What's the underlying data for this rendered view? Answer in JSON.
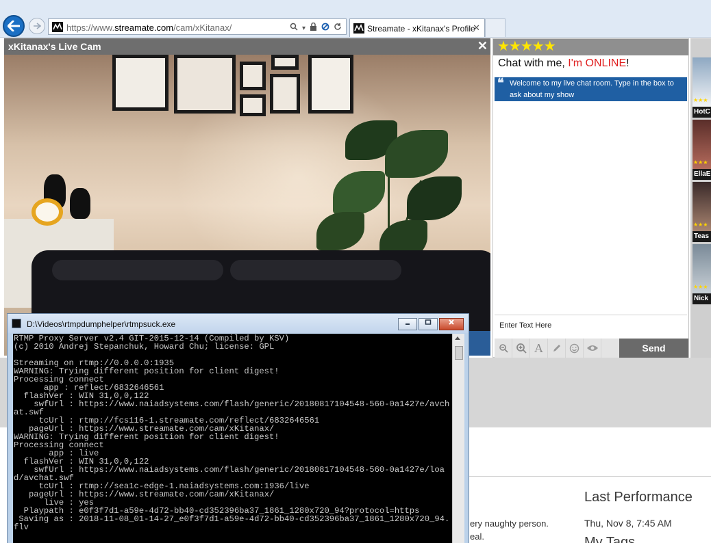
{
  "browser": {
    "url_prefix": "https://www.",
    "url_host": "streamate.com",
    "url_path": "/cam/xKitanax/",
    "url_dropdown": "▾",
    "tab_title": "Streamate - xKitanax's Profile",
    "tab_close": "✕"
  },
  "cam": {
    "title": "xKitanax's Live Cam",
    "close": "✕"
  },
  "chat": {
    "stars": "★★★★★",
    "heading_prefix": "Chat with me, ",
    "heading_online": "I'm ONLINE",
    "heading_suffix": "!",
    "welcome_quote": "❝",
    "welcome": "Welcome to my live chat room. Type in the box to ask about my show",
    "input_placeholder": "Enter Text Here",
    "send_label": "Send",
    "tools": [
      "zoom-out-icon",
      "zoom-in-icon",
      "font-icon",
      "pencil-icon",
      "smiley-icon",
      "eye-icon"
    ]
  },
  "thumbnails": [
    {
      "name": "HotC",
      "stars": "★★★"
    },
    {
      "name": "EllaE",
      "stars": "★★★"
    },
    {
      "name": "Teas",
      "stars": "★★★"
    },
    {
      "name": "Nick",
      "stars": "★★★"
    }
  ],
  "page": {
    "last_performance_heading": "Last Performance",
    "last_performance_date": "Thu, Nov 8, 7:45 AM",
    "my_tags_heading": "My Tags",
    "bio_line1": "ery naughty person.",
    "bio_line2": "eal."
  },
  "console": {
    "title": "D:\\Videos\\rtmpdumphelper\\rtmpsuck.exe",
    "text": "RTMP Proxy Server v2.4 GIT-2015-12-14 (Compiled by KSV)\n(c) 2010 Andrej Stepanchuk, Howard Chu; license: GPL\n\nStreaming on rtmp://0.0.0.0:1935\nWARNING: Trying different position for client digest!\nProcessing connect\n      app : reflect/6832646561\n  flashVer : WIN 31,0,0,122\n    swfUrl : https://www.naiadsystems.com/flash/generic/20180817104548-560-0a1427e/avchat.swf\n     tcUrl : rtmp://fcs116-1.streamate.com/reflect/6832646561\n   pageUrl : https://www.streamate.com/cam/xKitanax/\nWARNING: Trying different position for client digest!\nProcessing connect\n       app : live\n  flashVer : WIN 31,0,0,122\n    swfUrl : https://www.naiadsystems.com/flash/generic/20180817104548-560-0a1427e/load/avchat.swf\n     tcUrl : rtmp://sea1c-edge-1.naiadsystems.com:1936/live\n   pageUrl : https://www.streamate.com/cam/xKitanax/\n      live : yes\n  Playpath : e0f3f7d1-a59e-4d72-bb40-cd352396ba37_1861_1280x720_94?protocol=https\n Saving as : 2018-11-08_01-14-27_e0f3f7d1-a59e-4d72-bb40-cd352396ba37_1861_1280x720_94.flv"
  }
}
